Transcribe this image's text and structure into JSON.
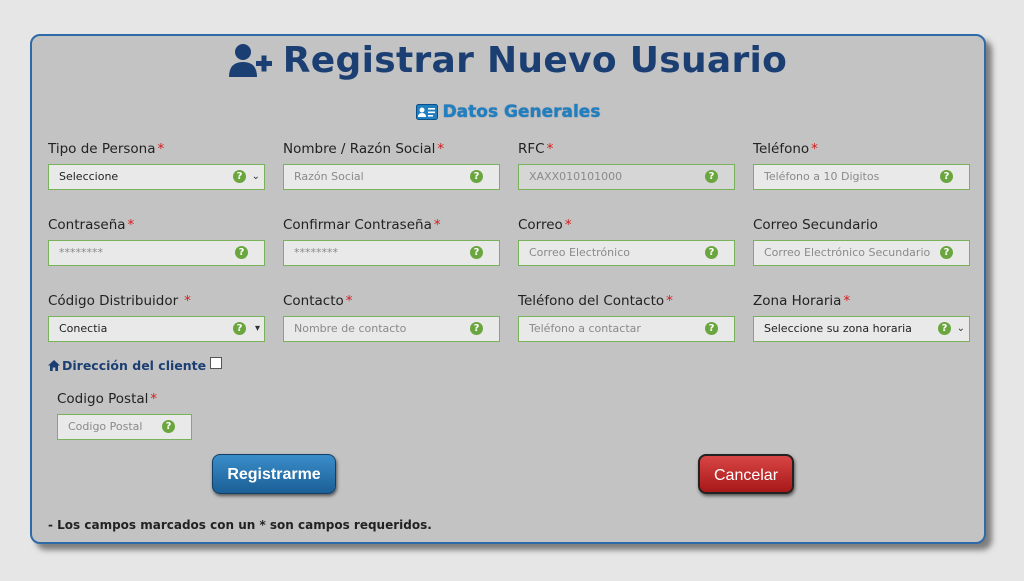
{
  "title": "Registrar Nuevo Usuario",
  "section": "Datos Generales",
  "required_mark": "*",
  "help_glyph": "?",
  "fields": [
    {
      "label": "Tipo de Persona",
      "value": "Seleccione",
      "type": "select"
    },
    {
      "label": "Nombre / Razón Social",
      "placeholder": "Razón Social",
      "type": "input"
    },
    {
      "label": "RFC",
      "placeholder": "XAXX010101000",
      "type": "input"
    },
    {
      "label": "Teléfono",
      "placeholder": "Teléfono a 10 Digitos",
      "type": "input"
    },
    {
      "label": "Contraseña",
      "placeholder": "********",
      "type": "input"
    },
    {
      "label": "Confirmar Contraseña",
      "placeholder": "********",
      "type": "input"
    },
    {
      "label": "Correo",
      "placeholder": "Correo Electrónico",
      "type": "input"
    },
    {
      "label": "Correo Secundario",
      "placeholder": "Correo Electrónico Secundario",
      "type": "input"
    },
    {
      "label": "Código Distribuidor",
      "value": "Conectia",
      "type": "select"
    },
    {
      "label": "Contacto",
      "placeholder": "Nombre de contacto",
      "type": "input"
    },
    {
      "label": "Teléfono del Contacto",
      "placeholder": "Teléfono a contactar",
      "type": "input"
    },
    {
      "label": "Zona Horaria",
      "value": "Seleccione su zona horaria",
      "type": "select"
    }
  ],
  "address": {
    "toggle_label": "Dirección del cliente",
    "postal_label": "Codigo Postal",
    "postal_placeholder": "Codigo Postal"
  },
  "buttons": {
    "register": "Registrarme",
    "cancel": "Cancelar"
  },
  "note": "- Los campos marcados con un * son campos requeridos.",
  "colors": {
    "title": "#1c3f73",
    "section": "#1f7fc1",
    "required": "#d51a1a",
    "border": "#7ab15b",
    "register": "#1b5f96",
    "cancel": "#a81818"
  }
}
